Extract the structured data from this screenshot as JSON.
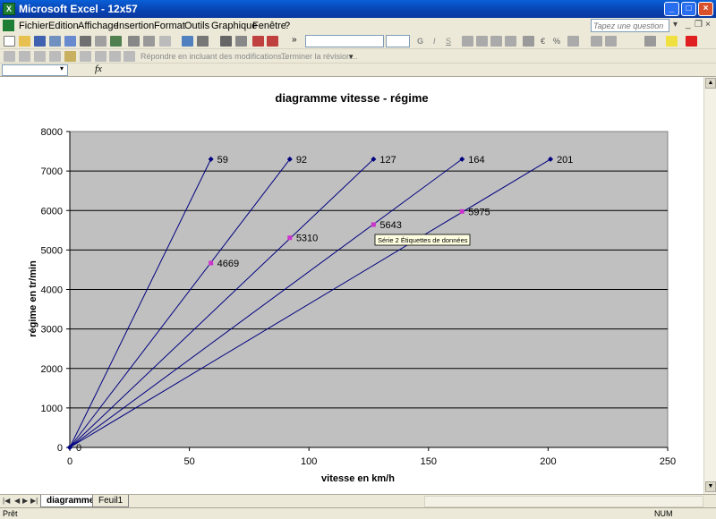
{
  "window": {
    "title": "Microsoft Excel - 12x57",
    "app_icon": "excel-icon"
  },
  "menu": {
    "items": [
      "Fichier",
      "Edition",
      "Affichage",
      "Insertion",
      "Format",
      "Outils",
      "Graphique",
      "Fenêtre",
      "?"
    ],
    "help_placeholder": "Tapez une question"
  },
  "toolbar": {
    "chevron": "»",
    "review_text": "Répondre en incluant des modifications...",
    "end_review_text": "Terminer la révision...",
    "bold": "G",
    "italic": "I",
    "underline": "S",
    "percent": "%",
    "euro": "€"
  },
  "formula": {
    "fx": "fx",
    "namebox_arrow": "▾"
  },
  "chart_data": {
    "type": "scatter",
    "title": "diagramme vitesse - régime",
    "xlabel": "vitesse en km/h",
    "ylabel": "régime en tr/min",
    "xlim": [
      0,
      250
    ],
    "ylim": [
      0,
      8000
    ],
    "xticks": [
      0,
      50,
      100,
      150,
      200,
      250
    ],
    "yticks": [
      0,
      1000,
      2000,
      3000,
      4000,
      5000,
      6000,
      7000,
      8000
    ],
    "grid": "horizontal",
    "plot_area_color": "#c0c0c0",
    "series": [
      {
        "color": "#000080",
        "points": [
          [
            0,
            0
          ],
          [
            59,
            7300
          ]
        ],
        "label": "59"
      },
      {
        "color": "#000080",
        "points": [
          [
            0,
            0
          ],
          [
            92,
            7300
          ]
        ],
        "label": "92"
      },
      {
        "color": "#000080",
        "points": [
          [
            0,
            0
          ],
          [
            127,
            7300
          ]
        ],
        "label": "127"
      },
      {
        "color": "#000080",
        "points": [
          [
            0,
            0
          ],
          [
            164,
            7300
          ]
        ],
        "label": "164"
      },
      {
        "color": "#000080",
        "points": [
          [
            0,
            0
          ],
          [
            201,
            7300
          ]
        ],
        "label": "201"
      }
    ],
    "series2": {
      "color": "#cc33cc",
      "points": [
        [
          59,
          4669
        ],
        [
          92,
          5310
        ],
        [
          127,
          5643
        ],
        [
          164,
          5975
        ]
      ],
      "labels": [
        "4669",
        "5310",
        "5643",
        "5975"
      ]
    },
    "origin_label": "0",
    "tooltip": "Série 2 Étiquettes de données"
  },
  "sheets": {
    "tabs": [
      "diagramme",
      "Feuil1"
    ],
    "active": "diagramme"
  },
  "status": {
    "left": "Prêt",
    "right": "NUM"
  }
}
